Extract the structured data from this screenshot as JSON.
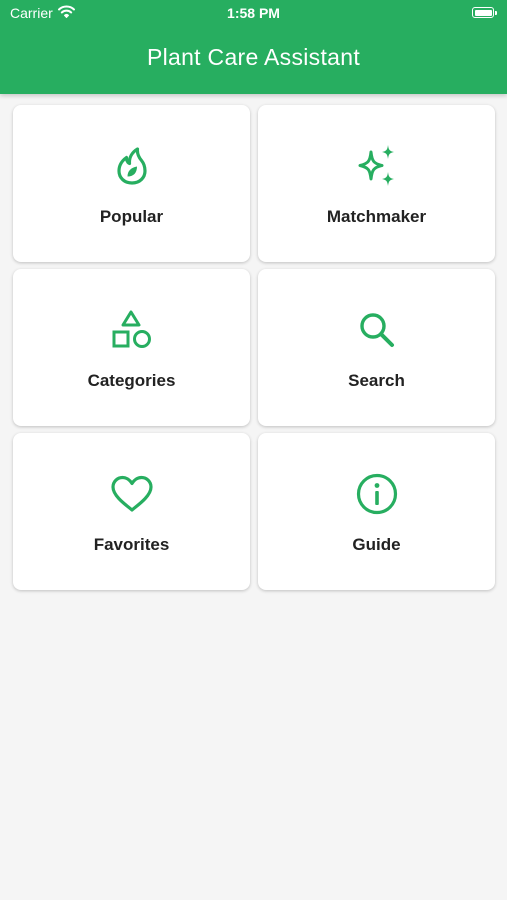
{
  "status_bar": {
    "carrier": "Carrier",
    "time": "1:58 PM"
  },
  "header": {
    "title": "Plant Care Assistant"
  },
  "colors": {
    "accent": "#27ae60",
    "background": "#f5f5f5",
    "card": "#ffffff",
    "text": "#222222"
  },
  "menu": {
    "items": [
      {
        "label": "Popular",
        "icon": "flame-icon"
      },
      {
        "label": "Matchmaker",
        "icon": "sparkles-icon"
      },
      {
        "label": "Categories",
        "icon": "shapes-icon"
      },
      {
        "label": "Search",
        "icon": "search-icon"
      },
      {
        "label": "Favorites",
        "icon": "heart-icon"
      },
      {
        "label": "Guide",
        "icon": "info-icon"
      }
    ]
  }
}
